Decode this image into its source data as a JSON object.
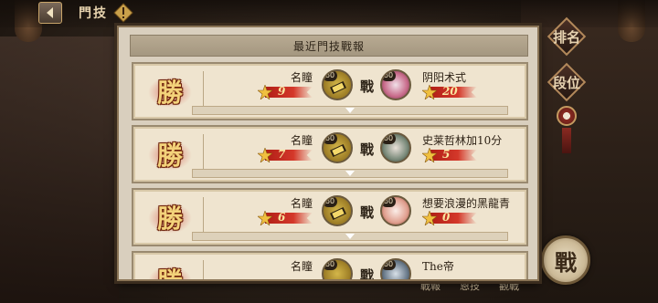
{
  "top_bar": {
    "title": "門技"
  },
  "side_buttons": {
    "ranking": "排名",
    "second": "段位"
  },
  "fight_button": "戰",
  "bottom_tabs": [
    "戰報",
    "恩技",
    "觀戰"
  ],
  "panel": {
    "title": "最近門技戰報",
    "records": [
      {
        "result": "勝",
        "left_name": "名瞳",
        "left_level": "60",
        "left_score": "9",
        "vs": "戰",
        "right_name": "阴阳术式",
        "right_level": "60",
        "right_score": "20"
      },
      {
        "result": "勝",
        "left_name": "名瞳",
        "left_level": "60",
        "left_score": "7",
        "vs": "戰",
        "right_name": "史莱哲林加10分",
        "right_level": "60",
        "right_score": "5"
      },
      {
        "result": "勝",
        "left_name": "名瞳",
        "left_level": "60",
        "left_score": "6",
        "vs": "戰",
        "right_name": "想要浪漫的黑龍青",
        "right_level": "60",
        "right_score": "0"
      },
      {
        "result": "勝",
        "left_name": "名瞳",
        "left_level": "60",
        "left_score": "",
        "vs": "戰",
        "right_name": "The帝",
        "right_level": "60",
        "right_score": ""
      }
    ]
  },
  "colors": {
    "accent_red": "#c8291e",
    "gold": "#f3d27a",
    "parchment": "#efe4cf"
  }
}
